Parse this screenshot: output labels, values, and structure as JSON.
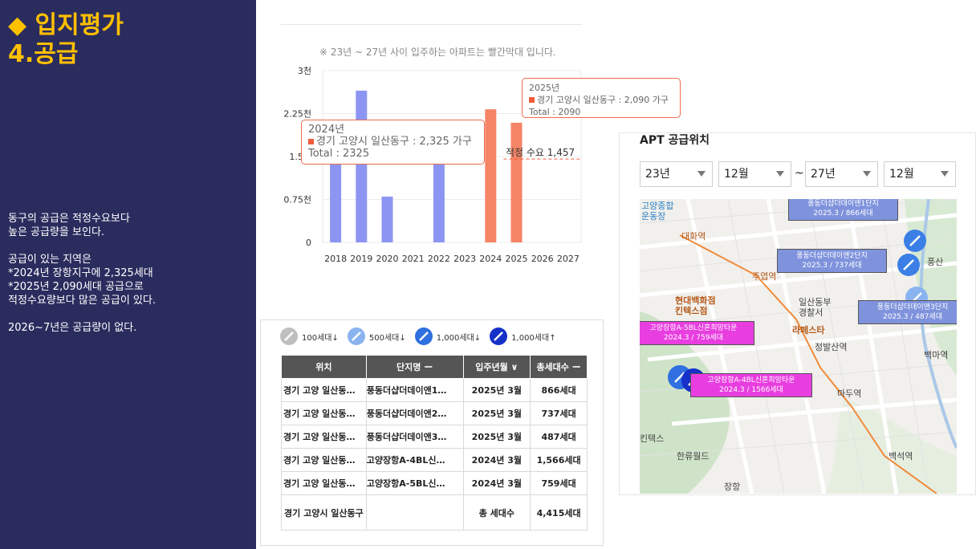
{
  "slide": {
    "title_line1": "◆ 입지평가",
    "title_line2": "4.공급",
    "paragraphs": [
      "동구의 공급은 적정수요보다\n높은 공급량을 보인다.",
      "공급이 있는 지역은\n*2024년 장항지구에 2,325세대\n*2025년 2,090세대 공급으로\n적정수요량보다 많은 공급이 있다.",
      "2026~7년은 공급량이 없다."
    ]
  },
  "chart_note": "※ 23년 ~ 27년 사이 입주하는 아파트는 빨간막대 입니다.",
  "chart_data": {
    "type": "bar",
    "categories": [
      "2018",
      "2019",
      "2020",
      "2021",
      "2022",
      "2023",
      "2024",
      "2025",
      "2026",
      "2027"
    ],
    "values": [
      1450,
      2650,
      800,
      0,
      1380,
      0,
      2325,
      2090,
      0,
      0
    ],
    "highlight_from": "2024",
    "colors": {
      "normal": "#8c96f2",
      "highlight": "#f58466"
    },
    "ylim": [
      0,
      3000
    ],
    "yticks": [
      "0",
      "0.75천",
      "1.5천",
      "2.25천",
      "3천"
    ],
    "ytick_values": [
      0,
      750,
      1500,
      2250,
      3000
    ],
    "reference_line": {
      "value": 1457,
      "label": "적정 수요 1,457",
      "color": "#ef5b3c"
    },
    "grid": true
  },
  "tooltips": {
    "t2024": {
      "year": "2024년",
      "series": "경기 고양시 일산동구 : 2,325 가구",
      "total": "Total : 2325"
    },
    "t2025": {
      "year": "2025년",
      "series": "경기 고양시 일산동구 : 2,090 가구",
      "total": "Total : 2090"
    }
  },
  "legend": [
    {
      "label": "100세대↓",
      "color": "#bfbfbf"
    },
    {
      "label": "500세대↓",
      "color": "#8ab4f0"
    },
    {
      "label": "1,000세대↓",
      "color": "#2f6fe0"
    },
    {
      "label": "1,000세대↑",
      "color": "#1531c8"
    }
  ],
  "table": {
    "headers": [
      "위치",
      "단지명 ー",
      "입주년월 ∨",
      "총세대수 ー"
    ],
    "rows": [
      {
        "loc": "경기 고양 일산동…",
        "name": "풍동더샵더데이앤1…",
        "date": "2025년 3월",
        "units": "866세대"
      },
      {
        "loc": "경기 고양 일산동…",
        "name": "풍동더샵더데이앤2…",
        "date": "2025년 3월",
        "units": "737세대"
      },
      {
        "loc": "경기 고양 일산동…",
        "name": "풍동더샵더데이앤3…",
        "date": "2025년 3월",
        "units": "487세대"
      },
      {
        "loc": "경기 고양 일산동…",
        "name": "고양장항A-4BL신…",
        "date": "2024년 3월",
        "units": "1,566세대"
      },
      {
        "loc": "경기 고양 일산동…",
        "name": "고양장항A-5BL신…",
        "date": "2024년 3월",
        "units": "759세대"
      }
    ],
    "total": {
      "loc": "경기 고양시 일산동구",
      "label": "총 세대수",
      "units": "4,415세대"
    }
  },
  "map_panel": {
    "title": "APT 공급위치",
    "from_year": "23년",
    "from_month": "12월",
    "tilde": "~",
    "to_year": "27년",
    "to_month": "12월",
    "labels": {
      "l1": "고양종합\n운동장",
      "l2": "대화역",
      "l3": "주엽역",
      "l4": "현대백화점\n킨텍스점",
      "l5": "일산동부\n경찰서",
      "l6": "라페스타",
      "l7": "정발산역",
      "l8": "백마역",
      "l9": "마두역",
      "l10": "킨텍스",
      "l11": "한류월드",
      "l12": "장항",
      "l13": "백석역",
      "l14": "풍산"
    },
    "callouts": [
      {
        "name": "풍동더샵더데이앤1단지",
        "info": "2025.3 / 866세대"
      },
      {
        "name": "풍동더샵더데이앤2단지",
        "info": "2025.3 / 737세대"
      },
      {
        "name": "풍동더샵더데이앤3단지",
        "info": "2025.3 / 487세대"
      },
      {
        "name": "고양장항A-5BL신혼희망타운",
        "info": "2024.3 / 759세대"
      },
      {
        "name": "고양장항A-4BL신혼희망타운",
        "info": "2024.3 / 1566세대"
      }
    ]
  }
}
